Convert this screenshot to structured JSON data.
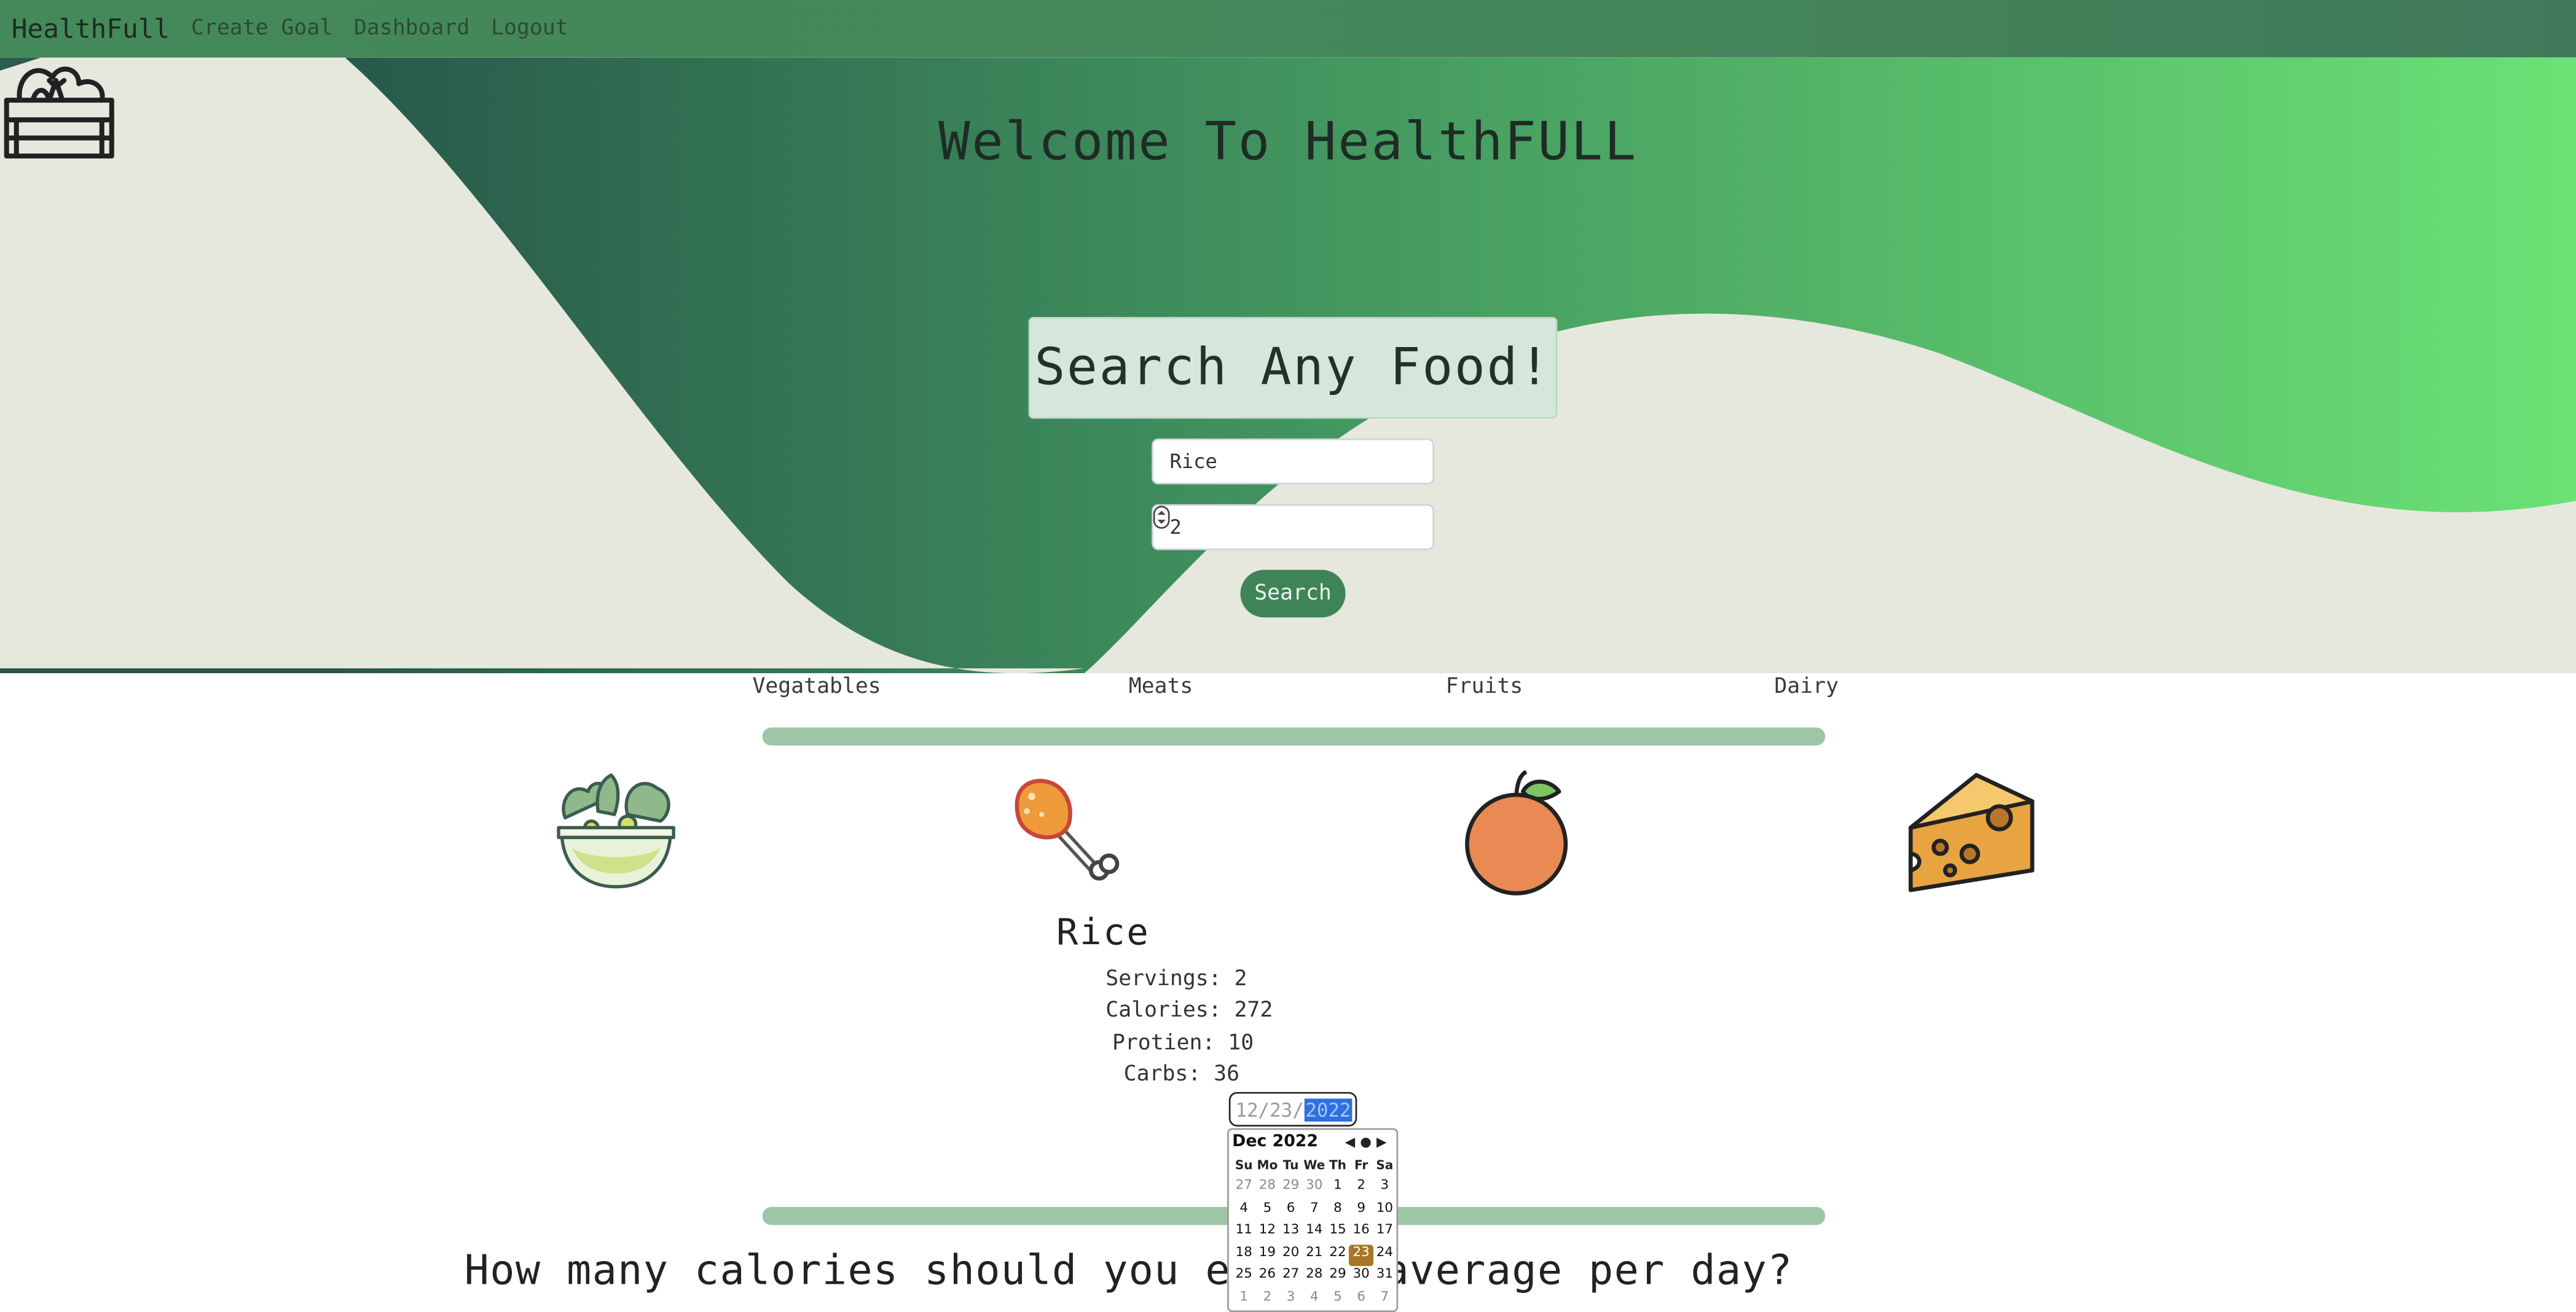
{
  "navbar": {
    "brand": "HealthFull",
    "links": [
      "Create Goal",
      "Dashboard",
      "Logout"
    ]
  },
  "hero": {
    "title": "Welcome To HealthFULL",
    "banner": "Search Any Food!",
    "food_input_value": "Rice",
    "servings_input_value": "2",
    "search_button": "Search"
  },
  "categories": [
    "Vegatables",
    "Meats",
    "Fruits",
    "Dairy"
  ],
  "category_icons": [
    "salad-bowl-icon",
    "chicken-drumstick-icon",
    "orange-icon",
    "cheese-icon"
  ],
  "result": {
    "name": "Rice",
    "servings": "Servings: 2",
    "calories": "Calories: 272",
    "protein": "Protien: 10",
    "carbs": "Carbs: 36"
  },
  "date_input": {
    "month": "12",
    "day": "23",
    "year": "2022"
  },
  "calendar": {
    "month_label": "Dec 2022",
    "weekdays": [
      "Su",
      "Mo",
      "Tu",
      "We",
      "Th",
      "Fr",
      "Sa"
    ],
    "selected_day": "23",
    "weeks": [
      [
        "27",
        "28",
        "29",
        "30",
        "1",
        "2",
        "3"
      ],
      [
        "4",
        "5",
        "6",
        "7",
        "8",
        "9",
        "10"
      ],
      [
        "11",
        "12",
        "13",
        "14",
        "15",
        "16",
        "17"
      ],
      [
        "18",
        "19",
        "20",
        "21",
        "22",
        "23",
        "24"
      ],
      [
        "25",
        "26",
        "27",
        "28",
        "29",
        "30",
        "31"
      ],
      [
        "1",
        "2",
        "3",
        "4",
        "5",
        "6",
        "7"
      ]
    ]
  },
  "question": "How many calories should you eat on average per day?",
  "colors": {
    "nav": "#44895a",
    "hero_dark": "#2a5d4d",
    "hero_light": "#6be275",
    "hero_bg": "#e6e7dd",
    "button": "#3f8459",
    "divider": "#9ec6a6",
    "calendar_selected": "#a57726"
  }
}
